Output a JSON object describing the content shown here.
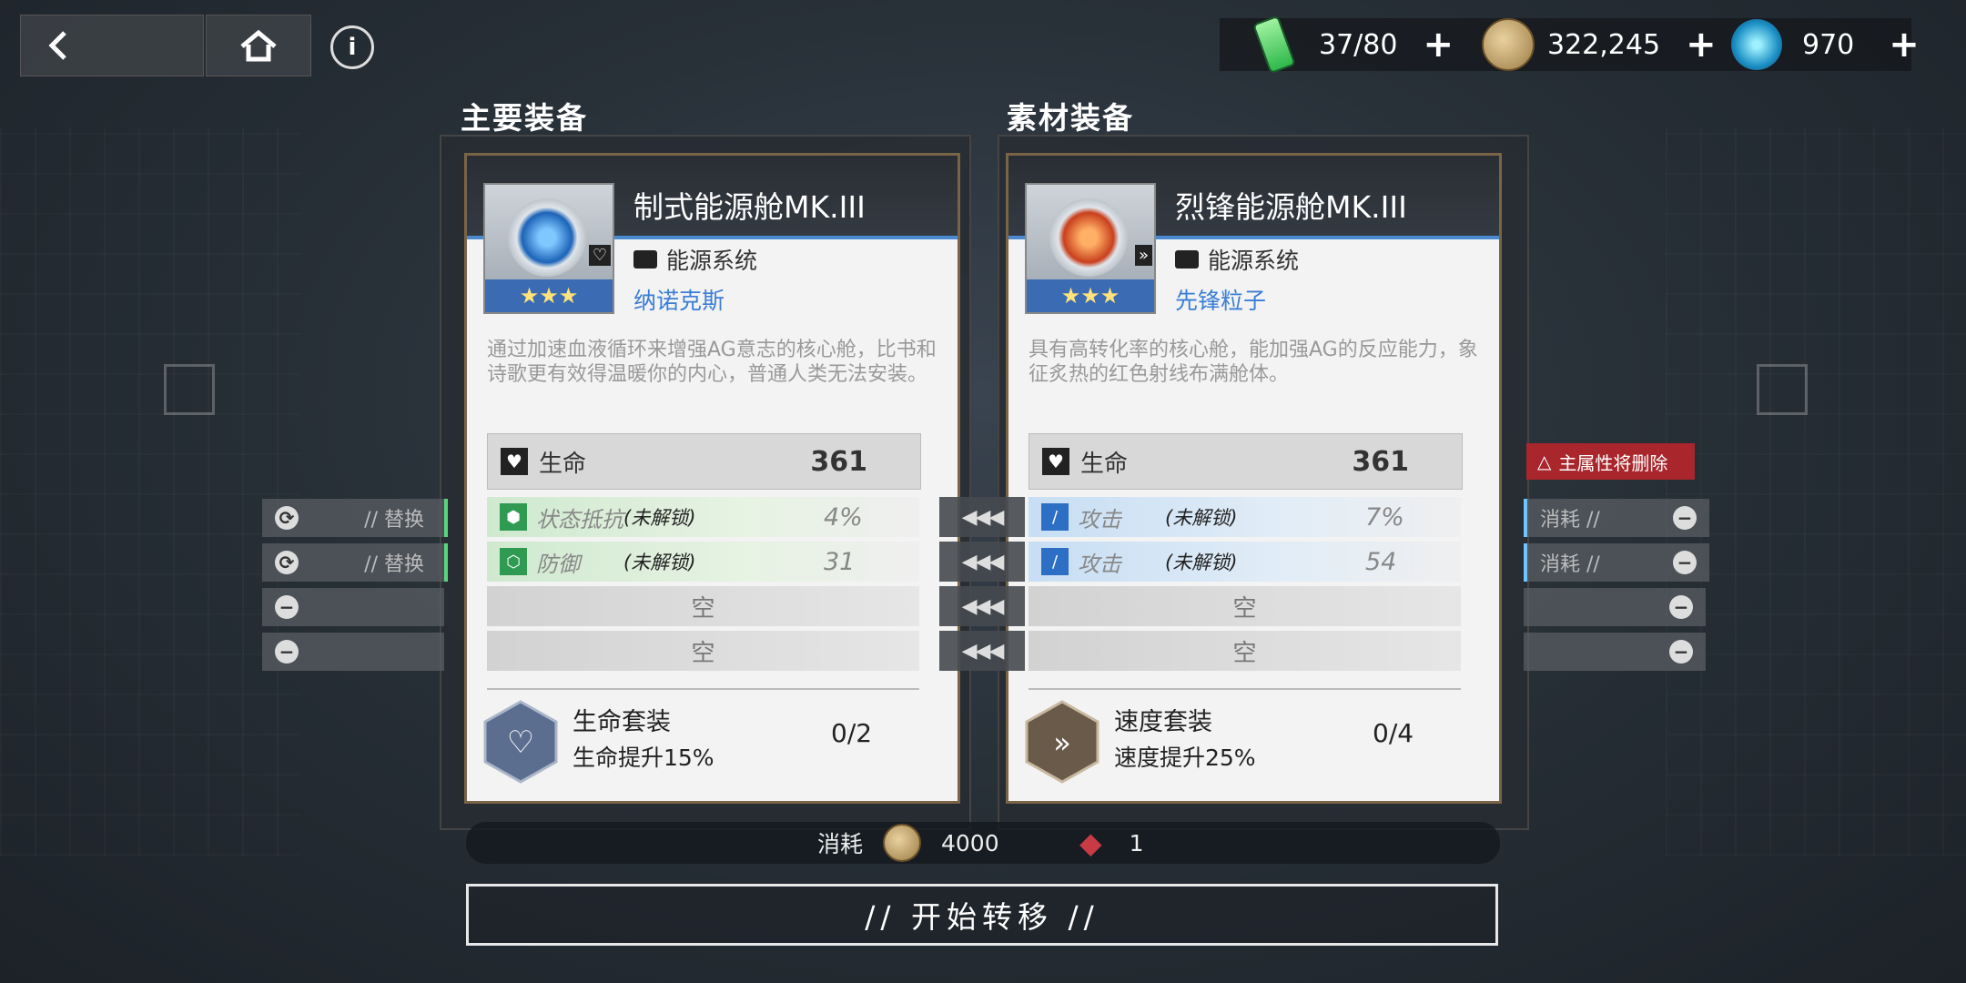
{
  "topbar": {
    "back_icon": "chevron-left-icon",
    "home_icon": "home-icon",
    "info_icon": "info-icon"
  },
  "resources": [
    {
      "name": "energy",
      "icon": "battery-icon",
      "value": "37/80",
      "plus": "+"
    },
    {
      "name": "coins",
      "icon": "coin-icon",
      "value": "322,245",
      "plus": "+"
    },
    {
      "name": "crystal",
      "icon": "crystal-icon",
      "value": "970",
      "plus": "+"
    }
  ],
  "sections": {
    "main": "主要装备",
    "material": "素材装备"
  },
  "main_card": {
    "name": "制式能源舱MK.III",
    "stars": "★★★",
    "system": "能源系统",
    "maker": "纳诺克斯",
    "description": "通过加速血液循环来增强AG意志的核心舱，比书和诗歌更有效得温暖你的内心，普通人类无法安装。",
    "main_stat": {
      "label": "生命",
      "value": "361"
    },
    "sub_stats": [
      {
        "label": "状态抵抗",
        "lock": "(未解锁)",
        "value": "4%"
      },
      {
        "label": "防御",
        "lock": "(未解锁)",
        "value": "31"
      },
      {
        "label": "空"
      },
      {
        "label": "空"
      }
    ],
    "set": {
      "name": "生命套装",
      "desc": "生命提升15%",
      "count": "0/2"
    }
  },
  "material_card": {
    "name": "烈锋能源舱MK.III",
    "stars": "★★★",
    "system": "能源系统",
    "maker": "先锋粒子",
    "description": "具有高转化率的核心舱，能加强AG的反应能力，象征炙热的红色射线布满舱体。",
    "main_stat": {
      "label": "生命",
      "value": "361"
    },
    "sub_stats": [
      {
        "label": "攻击",
        "lock": "(未解锁)",
        "value": "7%"
      },
      {
        "label": "攻击",
        "lock": "(未解锁)",
        "value": "54"
      },
      {
        "label": "空"
      },
      {
        "label": "空"
      }
    ],
    "set": {
      "name": "速度套装",
      "desc": "速度提升25%",
      "count": "0/4"
    }
  },
  "left_slots": [
    "// 替换",
    "// 替换"
  ],
  "right_slots": [
    "消耗 //",
    "消耗 //"
  ],
  "arrows": "◀◀◀",
  "warning": "主属性将删除",
  "cost": {
    "label": "消耗",
    "coins": "4000",
    "items": "1"
  },
  "start_button": "//   开始转移   //"
}
